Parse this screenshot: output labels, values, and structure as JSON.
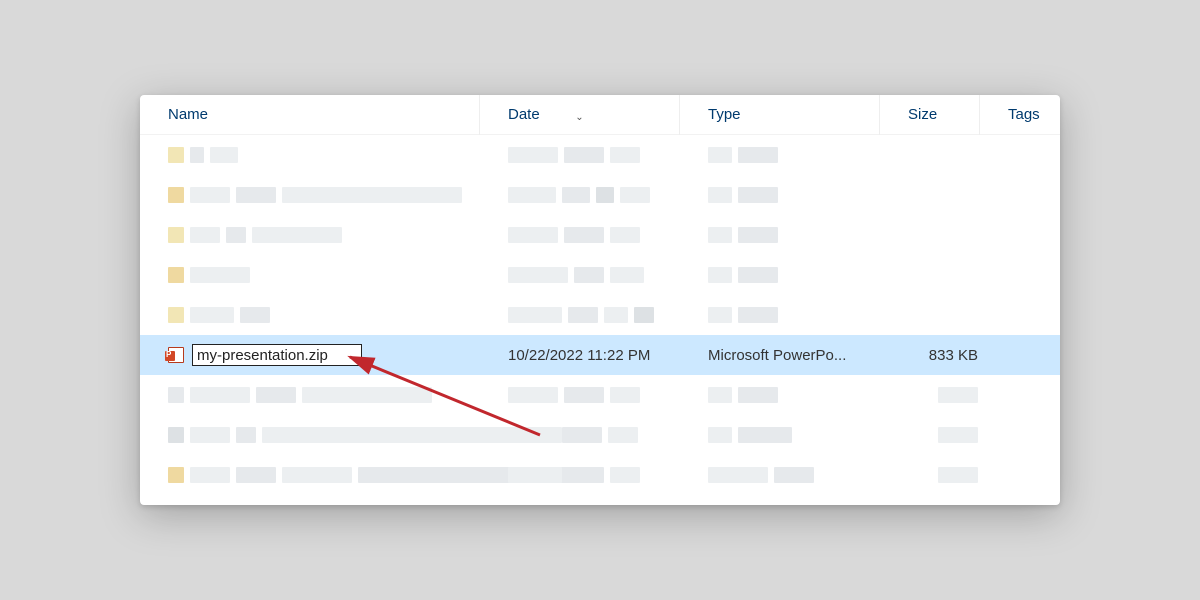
{
  "columns": {
    "name": "Name",
    "date": "Date",
    "type": "Type",
    "size": "Size",
    "tags": "Tags"
  },
  "selected_row": {
    "filename": "my-presentation.zip",
    "date": "10/22/2022 11:22 PM",
    "type": "Microsoft PowerPo...",
    "size": "833 KB"
  }
}
